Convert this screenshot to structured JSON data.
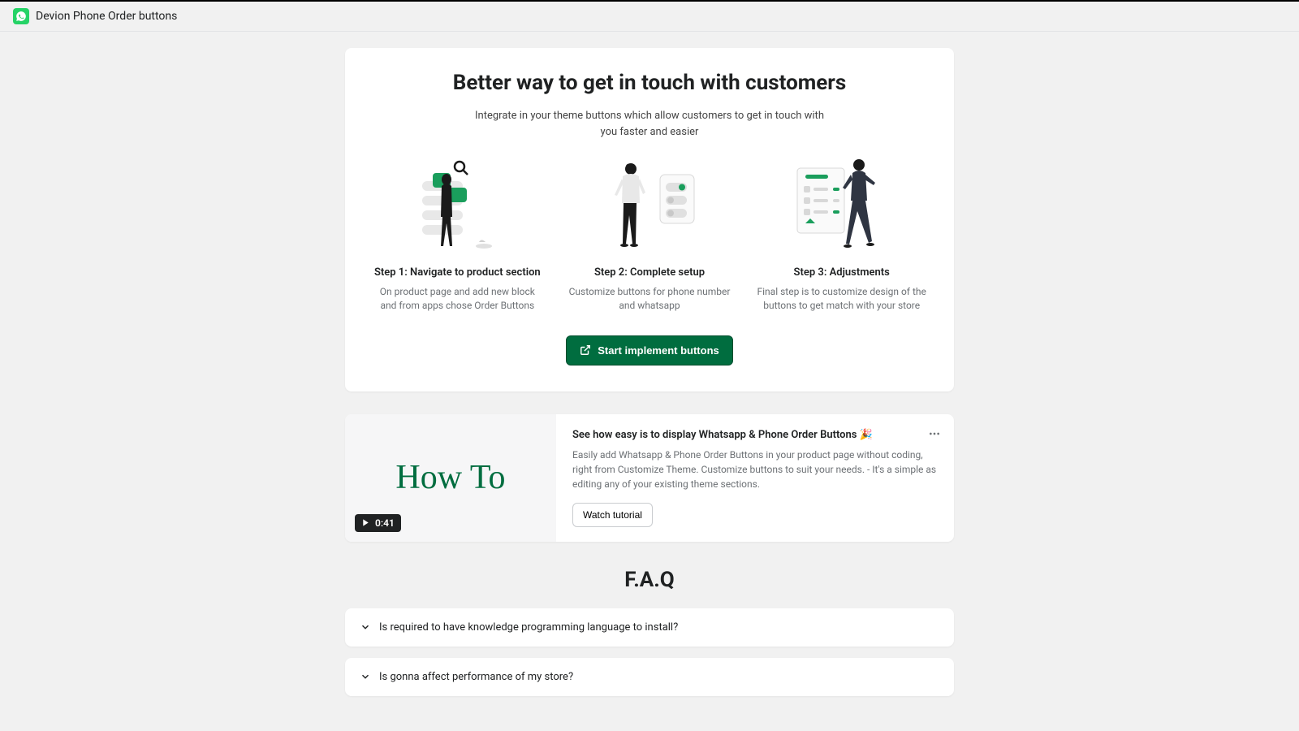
{
  "app": {
    "title": "Devion Phone Order buttons"
  },
  "hero": {
    "title": "Better way to get in touch with customers",
    "subtitle": "Integrate in your theme buttons which allow customers to get in touch with you faster and easier"
  },
  "steps": [
    {
      "title": "Step 1: Navigate to product section",
      "desc": "On product page and add new block and from apps chose Order Buttons"
    },
    {
      "title": "Step 2: Complete setup",
      "desc": "Customize buttons for phone number and whatsapp"
    },
    {
      "title": "Step 3: Adjustments",
      "desc": "Final step is to customize design of the buttons to get match with your store"
    }
  ],
  "cta": {
    "label": "Start implement buttons"
  },
  "howto": {
    "thumbnail_text": "How To",
    "duration": "0:41",
    "title": "See how easy is to display Whatsapp & Phone Order Buttons 🎉",
    "desc": "Easily add Whatsapp & Phone Order Buttons in your product page without coding, right from Customize Theme. Customize buttons to suit your needs. - It's a simple as editing any of your existing theme sections.",
    "watch_label": "Watch tutorial"
  },
  "faq": {
    "title": "F.A.Q",
    "items": [
      {
        "question": "Is required to have knowledge programming language to install?"
      },
      {
        "question": "Is gonna affect performance of my store?"
      }
    ]
  }
}
